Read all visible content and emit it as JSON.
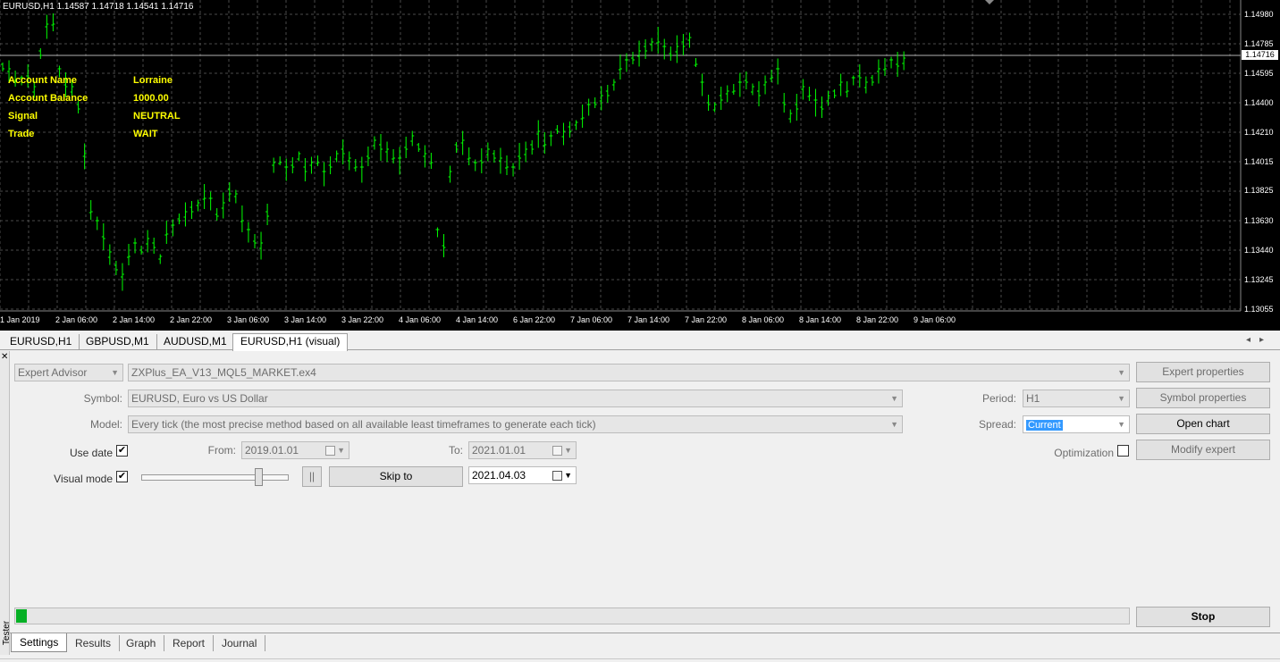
{
  "chart": {
    "header": "EURUSD,H1  1.14587 1.14718 1.14541 1.14716",
    "background": "#000000",
    "bar_color": "#00ff00",
    "grid_color": "#4a4a4a",
    "current_price": "1.14716",
    "price_axis": [
      "1.14980",
      "1.14785",
      "1.14595",
      "1.14400",
      "1.14210",
      "1.14015",
      "1.13825",
      "1.13630",
      "1.13440",
      "1.13245",
      "1.13055"
    ],
    "time_axis": [
      "1 Jan 2019",
      "2 Jan 06:00",
      "2 Jan 14:00",
      "2 Jan 22:00",
      "3 Jan 06:00",
      "3 Jan 14:00",
      "3 Jan 22:00",
      "4 Jan 06:00",
      "4 Jan 14:00",
      "6 Jan 22:00",
      "7 Jan 06:00",
      "7 Jan 14:00",
      "7 Jan 22:00",
      "8 Jan 06:00",
      "8 Jan 14:00",
      "8 Jan 22:00",
      "9 Jan 06:00"
    ],
    "info": [
      {
        "label": "Account Name",
        "value": "Lorraine"
      },
      {
        "label": "Account Balance",
        "value": "1000.00"
      },
      {
        "label": "Signal",
        "value": "NEUTRAL"
      },
      {
        "label": "Trade",
        "value": "WAIT"
      }
    ]
  },
  "chart_tabs": [
    "EURUSD,H1",
    "GBPUSD,M1",
    "AUDUSD,M1",
    "EURUSD,H1 (visual)"
  ],
  "tester": {
    "side_label": "Tester",
    "type_select": "Expert Advisor",
    "expert_file": "ZXPlus_EA_V13_MQL5_MARKET.ex4",
    "symbol_label": "Symbol:",
    "symbol_value": "EURUSD, Euro vs US Dollar",
    "model_label": "Model:",
    "model_value": "Every tick (the most precise method based on all available least timeframes to generate each tick)",
    "use_date_label": "Use date",
    "use_date_checked": "✔",
    "from_label": "From:",
    "from_value": "2019.01.01",
    "to_label": "To:",
    "to_value": "2021.01.01",
    "visual_mode_label": "Visual mode",
    "visual_mode_checked": "✔",
    "visual_speed": 0.8,
    "pause_label": "||",
    "skip_to_label": "Skip to",
    "skip_to_date": "2021.04.03",
    "period_label": "Period:",
    "period_value": "H1",
    "spread_label": "Spread:",
    "spread_value": "Current",
    "optimization_label": "Optimization",
    "buttons": {
      "expert_properties": "Expert properties",
      "symbol_properties": "Symbol properties",
      "open_chart": "Open chart",
      "modify_expert": "Modify expert",
      "stop": "Stop"
    },
    "progress": 0.01,
    "progress_color": "#06b025"
  },
  "bottom_tabs": [
    "Settings",
    "Results",
    "Graph",
    "Report",
    "Journal"
  ]
}
